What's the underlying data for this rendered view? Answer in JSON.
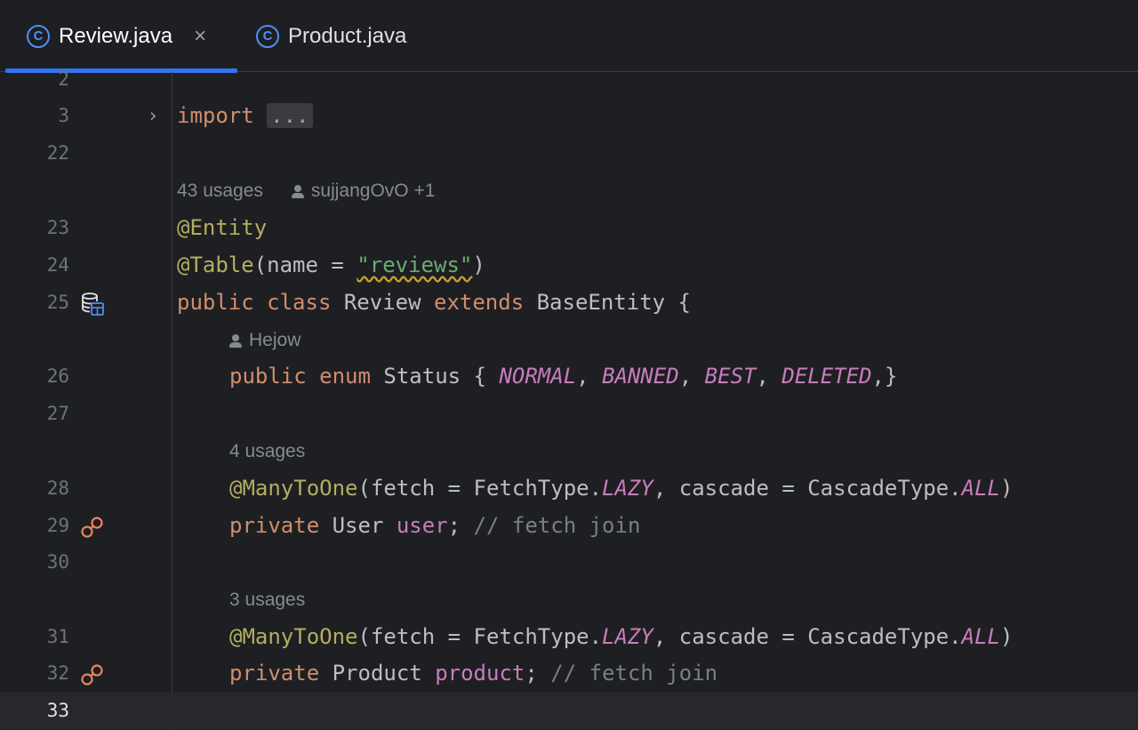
{
  "tabs": [
    {
      "label": "Review.java",
      "icon": "class-icon",
      "active": true,
      "close": "×"
    },
    {
      "label": "Product.java",
      "icon": "class-icon",
      "active": false
    }
  ],
  "editor": {
    "lines": {
      "l2": "2",
      "l3": "3",
      "l22": "22",
      "l23": "23",
      "l24": "24",
      "l25": "25",
      "l26": "26",
      "l27": "27",
      "l28": "28",
      "l29": "29",
      "l30": "30",
      "l31": "31",
      "l32": "32",
      "l33": "33"
    },
    "hints": {
      "class_usages": "43 usages",
      "class_authors": "sujjangOvO +1",
      "enum_author": "Hejow",
      "user_usages": "4 usages",
      "product_usages": "3 usages"
    },
    "code": {
      "import_kw": "import",
      "import_folded": "...",
      "entity_ann": "@Entity",
      "table_ann": "@Table",
      "table_open": "(name = ",
      "table_str": "\"reviews\"",
      "table_close": ")",
      "public": "public",
      "class": "class",
      "class_name": " Review ",
      "extends": "extends",
      "base": " BaseEntity {",
      "enum_public": "public",
      "enum": "enum",
      "enum_name": " Status { ",
      "normal": "NORMAL",
      "banned": "BANNED",
      "best": "BEST",
      "deleted": "DELETED",
      "comma_sp": ", ",
      "enum_end": ",}",
      "manytoone": "@ManyToOne",
      "fetch_part": "(fetch = FetchType.",
      "lazy": "LAZY",
      "cascade_part": ", cascade = CascadeType.",
      "all": "ALL",
      "paren_close": ")",
      "private": "private",
      "user_type": " User ",
      "user_field": "user",
      "product_type": " Product ",
      "product_field": "product",
      "semicolon_sp": "; ",
      "comment": "// fetch join"
    }
  },
  "colors": {
    "keyword": "#cf8e6d",
    "annotation": "#b3ae60",
    "string": "#6aab73",
    "constant": "#c77dbb",
    "comment": "#7a7e85",
    "accent": "#3574f0"
  }
}
